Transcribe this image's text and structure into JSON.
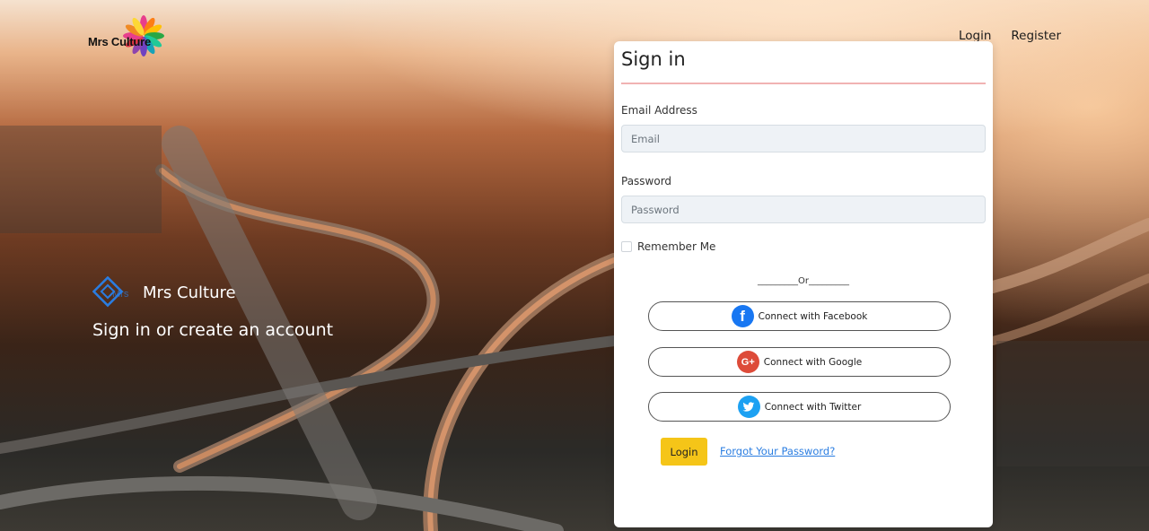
{
  "brand": {
    "logo_text": "Mrs Culture"
  },
  "nav": {
    "login": "Login",
    "register": "Register"
  },
  "hero": {
    "brand_text": "Mrs Culture",
    "subtitle": "Sign in or create an account"
  },
  "form": {
    "title": "Sign in",
    "email_label": "Email Address",
    "email_placeholder": "Email",
    "password_label": "Password",
    "password_placeholder": "Password",
    "remember_label": "Remember Me",
    "or_text": "_________Or_________",
    "facebook_label": "Connect with Facebook",
    "google_label": "Connect with Google",
    "twitter_label": "Connect with Twitter",
    "login_button": "Login",
    "forgot_link": "Forgot Your Password?"
  },
  "colors": {
    "facebook": "#1877f2",
    "google": "#dd4b39",
    "twitter": "#1da1f2",
    "login_button": "#f5c518",
    "link": "#2a7de1",
    "divider": "#f1b3b3"
  },
  "icons": {
    "facebook": "facebook-icon",
    "google": "google-plus-icon",
    "twitter": "twitter-icon"
  }
}
